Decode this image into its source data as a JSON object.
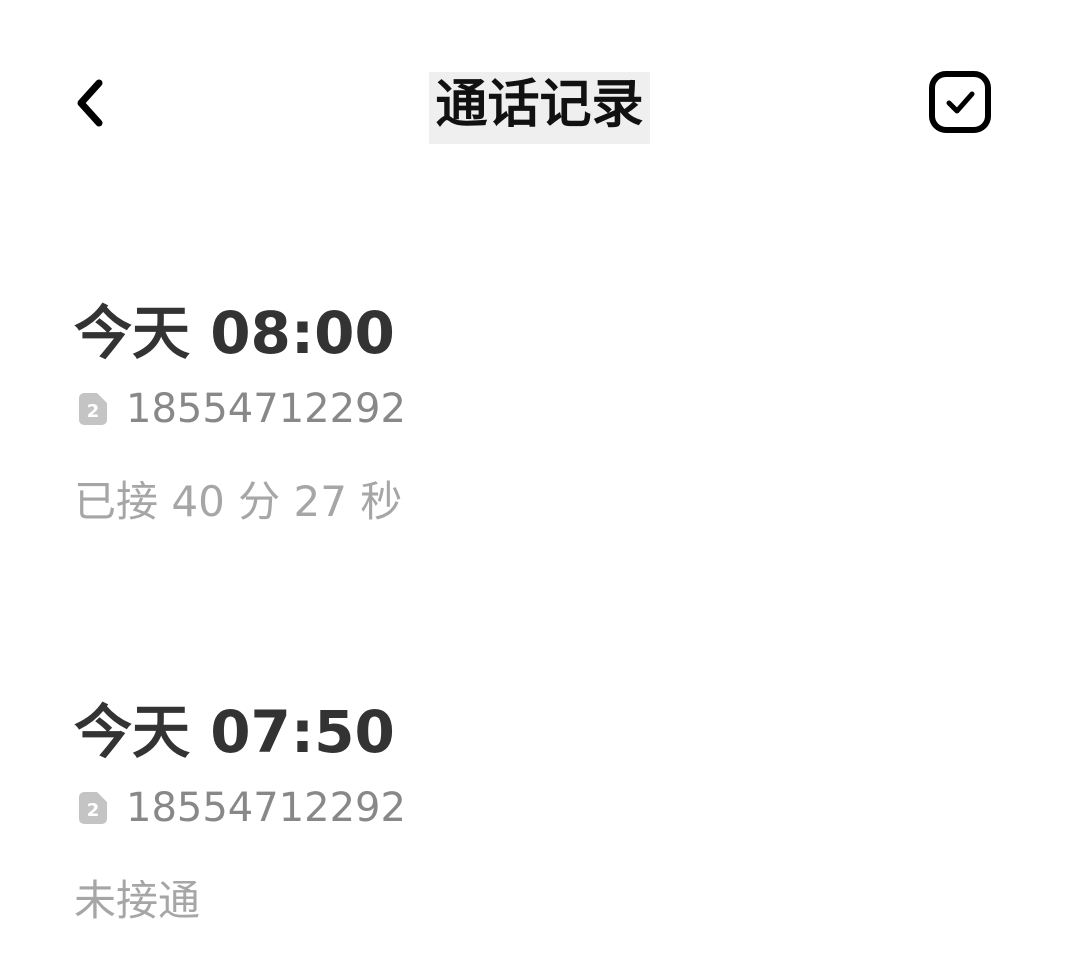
{
  "header": {
    "title": "通话记录",
    "back_icon": "chevron-left-icon",
    "select_icon": "checkbox-icon"
  },
  "sim_icon": {
    "name": "sim-2-icon",
    "label": "2",
    "color": "#c4c4c4"
  },
  "calls": [
    {
      "time": "今天 08:00",
      "number": "18554712292",
      "status": "已接 40 分 27 秒"
    },
    {
      "time": "今天 07:50",
      "number": "18554712292",
      "status": "未接通"
    }
  ]
}
